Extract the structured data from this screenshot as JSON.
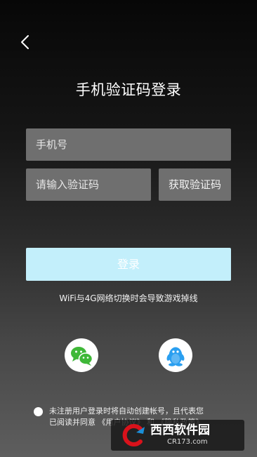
{
  "header": {
    "back_icon": "chevron-left-icon",
    "title": "手机验证码登录"
  },
  "form": {
    "phone_placeholder": "手机号",
    "code_placeholder": "请输入验证码",
    "get_code_label": "获取验证码",
    "login_label": "登录"
  },
  "notice": {
    "network_tip": "WiFi与4G网络切换时会导致游戏掉线"
  },
  "social": {
    "wechat_icon": "wechat-icon",
    "qq_icon": "qq-penguin-icon"
  },
  "agreement": {
    "checked": false,
    "line1": "未注册用户登录时将自动创建帐号，且代表您",
    "line2_prefix": "已阅读并同意 ",
    "user_agreement": "《用户协议》",
    "connector": " 和 ",
    "privacy_policy": "《隐私政策》"
  },
  "watermark": {
    "name": "西西软件园",
    "site": "CR173.com"
  },
  "colors": {
    "login_button": "#c3effb",
    "input_background": "#6f6f6f",
    "wechat_green": "#3fb838",
    "qq_blue": "#2a9ff0",
    "watermark_red": "#d9121b",
    "watermark_blue": "#1a8fd8"
  }
}
